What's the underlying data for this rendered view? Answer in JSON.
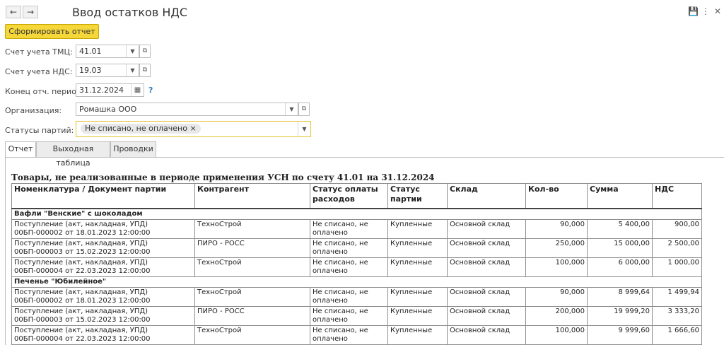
{
  "window": {
    "title": "Ввод остатков НДС"
  },
  "toolbar": {
    "generate_label": "Сформировать отчет"
  },
  "form": {
    "tmc_label": "Счет учета ТМЦ:",
    "tmc_value": "41.01",
    "nds_label": "Счет учета НДС:",
    "nds_value": "19.03",
    "period_label": "Конец отч. периода:",
    "period_value": "31.12.2024",
    "org_label": "Организация:",
    "org_value": "Ромашка ООО",
    "status_label": "Статусы партий:",
    "status_tag": "Не списано, не оплачено",
    "help": "?"
  },
  "tabs": [
    {
      "label": "Отчет"
    },
    {
      "label": "Выходная таблица"
    },
    {
      "label": "Проводки"
    }
  ],
  "report": {
    "title": "Товары, не реализованные в периоде применения УСН по счету 41.01 на 31.12.2024",
    "headers": [
      "Номенклатура / Документ партии",
      "Контрагент",
      "Статус оплаты расходов",
      "Статус партии",
      "Склад",
      "Кол-во",
      "Сумма",
      "НДС"
    ],
    "groups": [
      {
        "name": "Вафли \"Венские\" с шоколадом",
        "rows": [
          [
            "Поступление (акт, накладная, УПД) 00БП-000002 от 18.01.2023 12:00:00",
            "ТехноСтрой",
            "Не списано, не оплачено",
            "Купленные",
            "Основной склад",
            "90,000",
            "5 400,00",
            "900,00"
          ],
          [
            "Поступление (акт, накладная, УПД) 00БП-000003 от 15.02.2023 12:00:00",
            "ПИРО - РОСС",
            "Не списано, не оплачено",
            "Купленные",
            "Основной склад",
            "250,000",
            "15 000,00",
            "2 500,00"
          ],
          [
            "Поступление (акт, накладная, УПД) 00БП-000004 от 22.03.2023 12:00:00",
            "ТехноСтрой",
            "Не списано, не оплачено",
            "Купленные",
            "Основной склад",
            "100,000",
            "6 000,00",
            "1 000,00"
          ]
        ]
      },
      {
        "name": "Печенье \"Юбилейное\"",
        "rows": [
          [
            "Поступление (акт, накладная, УПД) 00БП-000002 от 18.01.2023 12:00:00",
            "ТехноСтрой",
            "Не списано, не оплачено",
            "Купленные",
            "Основной склад",
            "90,000",
            "8 999,64",
            "1 499,94"
          ],
          [
            "Поступление (акт, накладная, УПД) 00БП-000003 от 15.02.2023 12:00:00",
            "ПИРО - РОСС",
            "Не списано, не оплачено",
            "Купленные",
            "Основной склад",
            "200,000",
            "19 999,20",
            "3 333,20"
          ],
          [
            "Поступление (акт, накладная, УПД) 00БП-000004 от 22.03.2023 12:00:00",
            "ТехноСтрой",
            "Не списано, не оплачено",
            "Купленные",
            "Основной склад",
            "100,000",
            "9 999,60",
            "1 666,60"
          ]
        ]
      }
    ]
  }
}
